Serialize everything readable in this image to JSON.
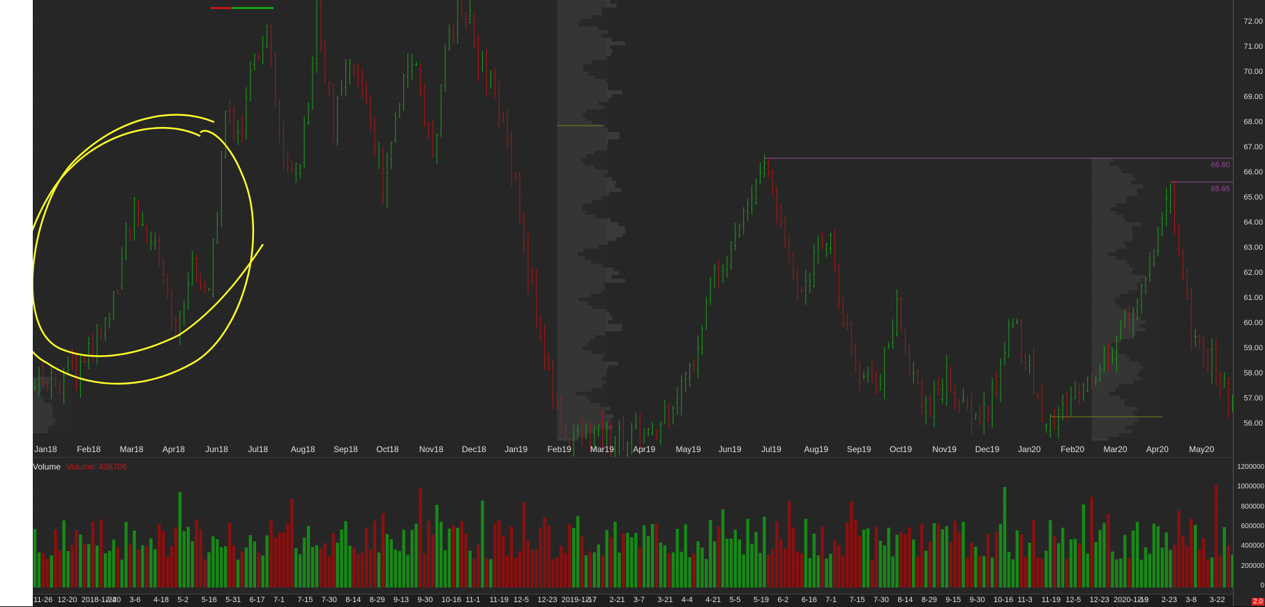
{
  "price_axis": {
    "labels": [
      "72.00",
      "71.00",
      "70.00",
      "69.00",
      "68.00",
      "67.00",
      "66.00",
      "65.00",
      "64.00",
      "63.00",
      "62.00",
      "61.00",
      "60.00",
      "59.00",
      "58.00",
      "57.00",
      "56.00"
    ],
    "levels": [
      72,
      71,
      70,
      69,
      68,
      67,
      66,
      65,
      64,
      63,
      62,
      61,
      60,
      59,
      58,
      57,
      56
    ],
    "top_value": 72.9,
    "bottom_value": 55.45
  },
  "month_axis": {
    "labels": [
      "Jan18",
      "Feb18",
      "Mar18",
      "Apr18",
      "Jun18",
      "Jul18",
      "Aug18",
      "Sep18",
      "Oct18",
      "Nov18",
      "Dec18",
      "Jan19",
      "Feb19",
      "Mar19",
      "Apr19",
      "May19",
      "Jun19",
      "Jul19",
      "Aug19",
      "Sep19",
      "Oct19",
      "Nov19",
      "Dec19",
      "Jan20",
      "Feb20",
      "Mar20",
      "Apr20",
      "May20"
    ]
  },
  "date_axis": {
    "labels": [
      "11-26",
      "12-20",
      "2018-1-24",
      "2-20",
      "3-6",
      "4-18",
      "5-2",
      "5-16",
      "5-31",
      "6-17",
      "7-1",
      "7-15",
      "7-30",
      "8-14",
      "8-29",
      "9-13",
      "9-30",
      "10-16",
      "11-1",
      "11-19",
      "12-5",
      "12-23",
      "2019-1-17",
      "2-7",
      "2-21",
      "3-7",
      "3-21",
      "4-4",
      "4-21",
      "5-5",
      "5-19",
      "6-2",
      "6-16",
      "7-1",
      "7-15",
      "7-30",
      "8-14",
      "8-29",
      "9-15",
      "9-30",
      "10-16",
      "11-3",
      "11-19",
      "12-5",
      "12-23",
      "2020-1-19",
      "2-9",
      "2-23",
      "3-8",
      "3-22"
    ]
  },
  "volume_panel": {
    "title": "Volume",
    "readout": "Volume: 438706",
    "axis_labels": [
      "1200000",
      "1000000",
      "800000",
      "600000",
      "400000",
      "200000",
      "0"
    ],
    "axis_values": [
      1200000,
      1000000,
      800000,
      600000,
      400000,
      200000,
      0
    ],
    "max_value": 1300000
  },
  "levels_lines": [
    {
      "label": "66.60",
      "value": 66.6
    },
    {
      "label": "65.65",
      "value": 65.65
    }
  ],
  "corner_badge": "2.0",
  "colors": {
    "background": "#262626",
    "up": "#1ea01e",
    "down": "#b41414",
    "up_volume": "#178a17",
    "down_volume": "#8a1010",
    "annotation": "#ffff2a",
    "level_line": "#9a4a9a",
    "poc_line": "#7a7a20",
    "profile": "#3a3a3a"
  },
  "chart_data": {
    "type": "candlestick",
    "title": "",
    "y_range": [
      55.45,
      72.9
    ],
    "price_path": [
      [
        0,
        57.6
      ],
      [
        10,
        58.1
      ],
      [
        18,
        60.4
      ],
      [
        24,
        64.5
      ],
      [
        30,
        62.8
      ],
      [
        34,
        59.5
      ],
      [
        38,
        62.5
      ],
      [
        42,
        61.0
      ],
      [
        46,
        68.3
      ],
      [
        50,
        67.8
      ],
      [
        52,
        69.8
      ],
      [
        56,
        72.2
      ],
      [
        60,
        66.0
      ],
      [
        64,
        65.8
      ],
      [
        68,
        72.6
      ],
      [
        72,
        68.0
      ],
      [
        76,
        70.1
      ],
      [
        80,
        69.0
      ],
      [
        84,
        65.5
      ],
      [
        88,
        69.0
      ],
      [
        92,
        70.5
      ],
      [
        96,
        66.5
      ],
      [
        100,
        71.7
      ],
      [
        104,
        72.6
      ],
      [
        108,
        70.0
      ],
      [
        112,
        68.5
      ],
      [
        116,
        65.8
      ],
      [
        118,
        63.0
      ],
      [
        122,
        59.5
      ],
      [
        126,
        56.5
      ],
      [
        128,
        55.5
      ],
      [
        150,
        55.5
      ],
      [
        152,
        56.5
      ],
      [
        158,
        58.0
      ],
      [
        164,
        62.0
      ],
      [
        170,
        64.2
      ],
      [
        174,
        65.5
      ],
      [
        176,
        66.5
      ],
      [
        180,
        64.0
      ],
      [
        184,
        61.5
      ],
      [
        188,
        62.5
      ],
      [
        192,
        63.5
      ],
      [
        196,
        59.5
      ],
      [
        200,
        57.5
      ],
      [
        204,
        58.0
      ],
      [
        208,
        60.5
      ],
      [
        212,
        58.0
      ],
      [
        216,
        56.5
      ],
      [
        220,
        58.0
      ],
      [
        224,
        56.5
      ],
      [
        228,
        56.2
      ],
      [
        232,
        57.5
      ],
      [
        236,
        60.5
      ],
      [
        240,
        58.0
      ],
      [
        244,
        56.0
      ],
      [
        248,
        56.5
      ],
      [
        252,
        57.5
      ],
      [
        256,
        58.0
      ],
      [
        260,
        59.0
      ],
      [
        264,
        60.5
      ],
      [
        268,
        61.5
      ],
      [
        270,
        63.0
      ],
      [
        272,
        64.5
      ],
      [
        274,
        65.3
      ],
      [
        276,
        62.5
      ],
      [
        280,
        59.0
      ],
      [
        284,
        58.5
      ],
      [
        288,
        57.0
      ],
      [
        290,
        55.8
      ]
    ],
    "volume_series": "one bar per session, green for up days and red for down days, 0 to about 1250000"
  }
}
